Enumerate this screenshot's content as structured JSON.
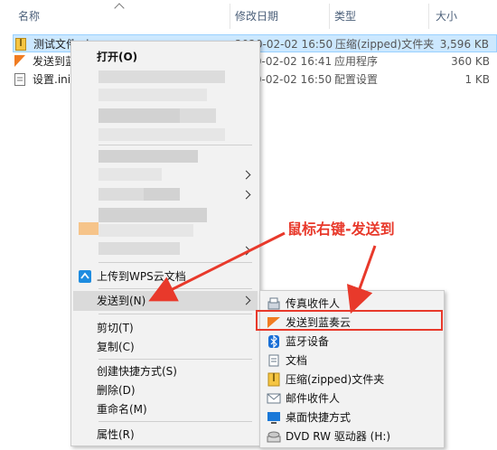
{
  "columns": {
    "name": "名称",
    "date": "修改日期",
    "type": "类型",
    "size": "大小"
  },
  "files": [
    {
      "name": "测试文件.zip",
      "date": "2020-02-02 16:50",
      "type": "压缩(zipped)文件夹",
      "size": "3,596 KB",
      "selected": true
    },
    {
      "name": "发送到蓝奏云.exe",
      "date": "2020-02-02 16:41",
      "type": "应用程序",
      "size": "360 KB",
      "selected": false
    },
    {
      "name": "设置.ini",
      "date": "2020-02-02 16:50",
      "type": "配置设置",
      "size": "1 KB",
      "selected": false
    }
  ],
  "context_menu": {
    "open": "打开(O)",
    "upload_wps": "上传到WPS云文档",
    "send_to": "发送到(N)",
    "cut": "剪切(T)",
    "copy": "复制(C)",
    "create_shortcut": "创建快捷方式(S)",
    "delete": "删除(D)",
    "rename": "重命名(M)",
    "properties": "属性(R)"
  },
  "submenu": {
    "items": [
      {
        "label": "传真收件人",
        "icon": "fax-icon"
      },
      {
        "label": "发送到蓝奏云",
        "icon": "lanzou-icon"
      },
      {
        "label": "蓝牙设备",
        "icon": "bluetooth-icon"
      },
      {
        "label": "文档",
        "icon": "documents-icon"
      },
      {
        "label": "压缩(zipped)文件夹",
        "icon": "zip-folder-icon"
      },
      {
        "label": "邮件收件人",
        "icon": "mail-icon"
      },
      {
        "label": "桌面快捷方式",
        "icon": "desktop-icon"
      },
      {
        "label": "DVD RW 驱动器 (H:)",
        "icon": "dvd-drive-icon"
      }
    ]
  },
  "annotation": {
    "text": "鼠标右键-发送到"
  },
  "colors": {
    "accent_red": "#e8392b",
    "selection": "#cce8ff",
    "menu_bg": "#f2f2f2"
  }
}
